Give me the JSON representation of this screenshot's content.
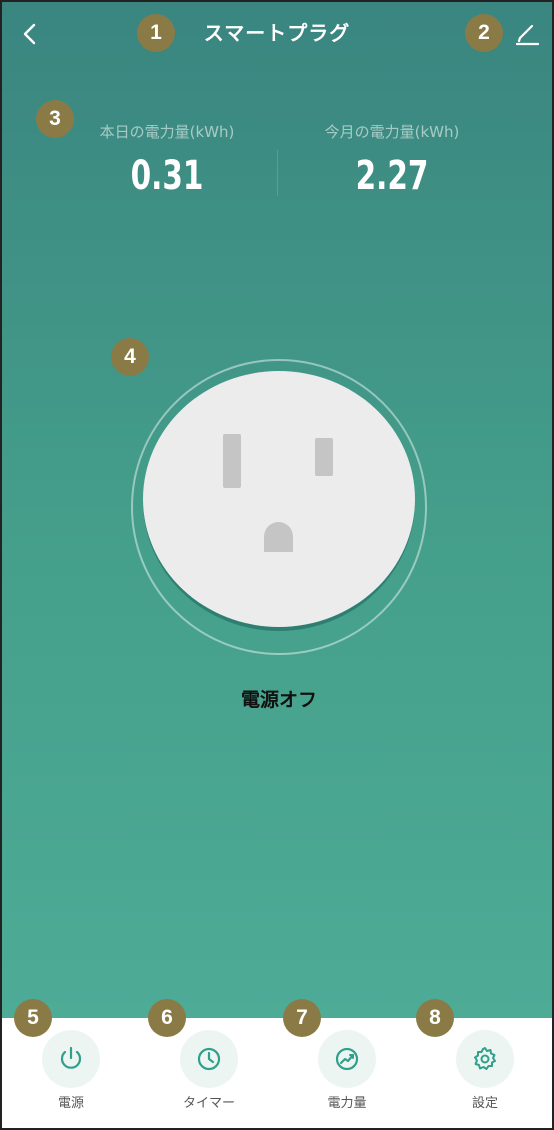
{
  "header": {
    "title": "スマートプラグ",
    "back_icon": "chevron-left-icon",
    "edit_icon": "pencil-icon"
  },
  "stats": {
    "today_label": "本日の電力量(kWh)",
    "today_value": "0.31",
    "month_label": "今月の電力量(kWh)",
    "month_value": "2.27"
  },
  "device": {
    "status": "電源オフ"
  },
  "bottom_nav": {
    "items": [
      {
        "label": "電源",
        "icon": "power-icon"
      },
      {
        "label": "タイマー",
        "icon": "clock-icon"
      },
      {
        "label": "電力量",
        "icon": "trend-chart-icon"
      },
      {
        "label": "設定",
        "icon": "gear-icon"
      }
    ]
  },
  "annotations": {
    "badges": [
      "1",
      "2",
      "3",
      "4",
      "5",
      "6",
      "7",
      "8"
    ]
  },
  "colors": {
    "accent": "#2fa08a",
    "badge": "#8a7b46",
    "gradient_top": "#3a8580",
    "gradient_bottom": "#4dab96"
  }
}
